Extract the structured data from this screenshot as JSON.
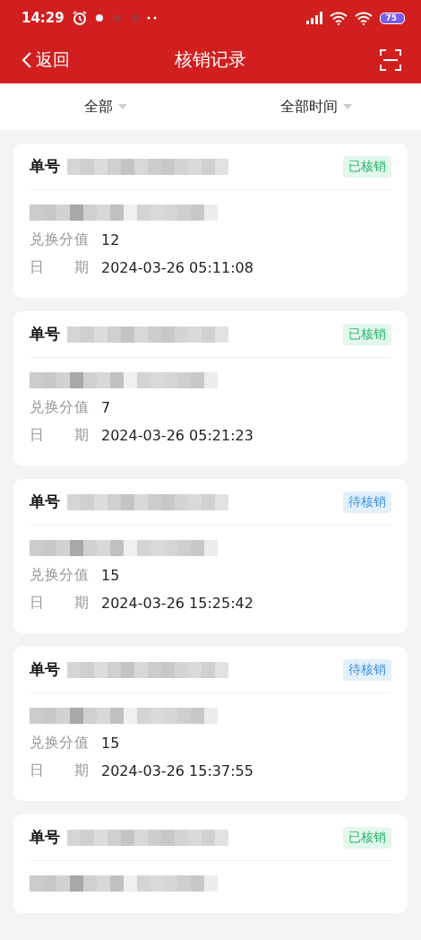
{
  "status_bar": {
    "time": "14:29",
    "battery": "75"
  },
  "nav": {
    "back": "返回",
    "title": "核销记录"
  },
  "filters": [
    {
      "label": "全部"
    },
    {
      "label": "全部时间"
    }
  ],
  "records": [
    {
      "order_label": "单号",
      "status": "已核销",
      "kind": "done",
      "fields": [
        {
          "label": "兑换分值",
          "value": "12"
        },
        {
          "label": "日期",
          "value": "2024-03-26 05:11:08"
        }
      ]
    },
    {
      "order_label": "单号",
      "status": "已核销",
      "kind": "done",
      "fields": [
        {
          "label": "兑换分值",
          "value": "7"
        },
        {
          "label": "日期",
          "value": "2024-03-26 05:21:23"
        }
      ]
    },
    {
      "order_label": "单号",
      "status": "待核销",
      "kind": "pending",
      "fields": [
        {
          "label": "兑换分值",
          "value": "15"
        },
        {
          "label": "日期",
          "value": "2024-03-26 15:25:42"
        }
      ]
    },
    {
      "order_label": "单号",
      "status": "待核销",
      "kind": "pending",
      "fields": [
        {
          "label": "兑换分值",
          "value": "15"
        },
        {
          "label": "日期",
          "value": "2024-03-26 15:37:55"
        }
      ]
    },
    {
      "order_label": "单号",
      "status": "已核销",
      "kind": "done"
    }
  ]
}
